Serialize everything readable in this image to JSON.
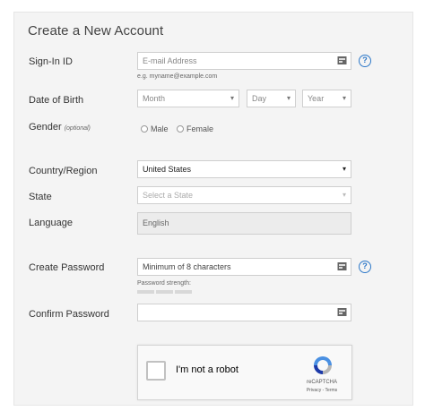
{
  "form": {
    "title": "Create a New Account",
    "signin": {
      "label": "Sign-In ID",
      "placeholder": "E-mail Address",
      "hint": "e.g. myname@example.com",
      "help": "?"
    },
    "dob": {
      "label": "Date of Birth",
      "month": "Month",
      "day": "Day",
      "year": "Year"
    },
    "gender": {
      "label": "Gender",
      "optional": "(optional)",
      "male": "Male",
      "female": "Female"
    },
    "country": {
      "label": "Country/Region",
      "value": "United States"
    },
    "state": {
      "label": "State",
      "placeholder": "Select a State"
    },
    "language": {
      "label": "Language",
      "value": "English"
    },
    "password": {
      "label": "Create Password",
      "placeholder": "Minimum of 8 characters",
      "strength_label": "Password strength:",
      "help": "?"
    },
    "confirm": {
      "label": "Confirm Password",
      "value": ""
    }
  },
  "captcha": {
    "label": "I'm not a robot",
    "brand": "reCAPTCHA",
    "links": "Privacy - Terms"
  },
  "colors": {
    "help_blue": "#2d78c8",
    "panel_bg": "#f4f4f4"
  }
}
